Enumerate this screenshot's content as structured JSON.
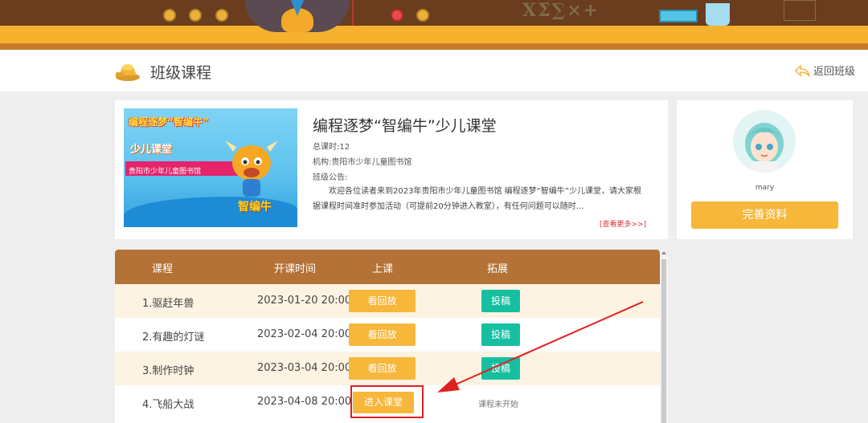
{
  "header": {
    "title": "班级课程",
    "back_label": "返回班级"
  },
  "course": {
    "title": "编程逐梦“智编牛”少儿课堂",
    "total": "总课时:12",
    "org": "机构:贵阳市少年儿童图书馆",
    "notice_label": "班级公告:",
    "notice_text": "欢迎各位读者来到2023年贵阳市少年儿童图书馆 编程逐梦“智编牛”少儿课堂，请大家根据课程时间准时参加活动（可提前20分钟进入教室），有任何问题可以随时...",
    "more_label": "[查看更多>>]",
    "poster": {
      "line1": "编程逐梦“智编牛”",
      "line2": "少儿课堂",
      "ribbon": "贵阳市少年儿童图书馆",
      "logo": "智编牛"
    }
  },
  "profile": {
    "username": "mary",
    "complete_label": "完善资料"
  },
  "table": {
    "headers": [
      "课程",
      "开课时间",
      "上课",
      "拓展"
    ],
    "rows": [
      {
        "name": "1.驱赶年兽",
        "time": "2023-01-20 20:00",
        "action": "看回放",
        "extra": "投稿"
      },
      {
        "name": "2.有趣的灯谜",
        "time": "2023-02-04 20:00",
        "action": "看回放",
        "extra": "投稿"
      },
      {
        "name": "3.制作时钟",
        "time": "2023-03-04 20:00",
        "action": "看回放",
        "extra": "投稿"
      },
      {
        "name": "4.飞船大战",
        "time": "2023-04-08 20:00",
        "action": "进入课堂",
        "status": "课程未开始"
      }
    ]
  },
  "colors": {
    "banner_yellow": "#f6b12f",
    "table_header": "#b57236",
    "orange_button": "#f7b73b",
    "teal_button": "#17bfa1",
    "annotation_red": "#e02020"
  }
}
